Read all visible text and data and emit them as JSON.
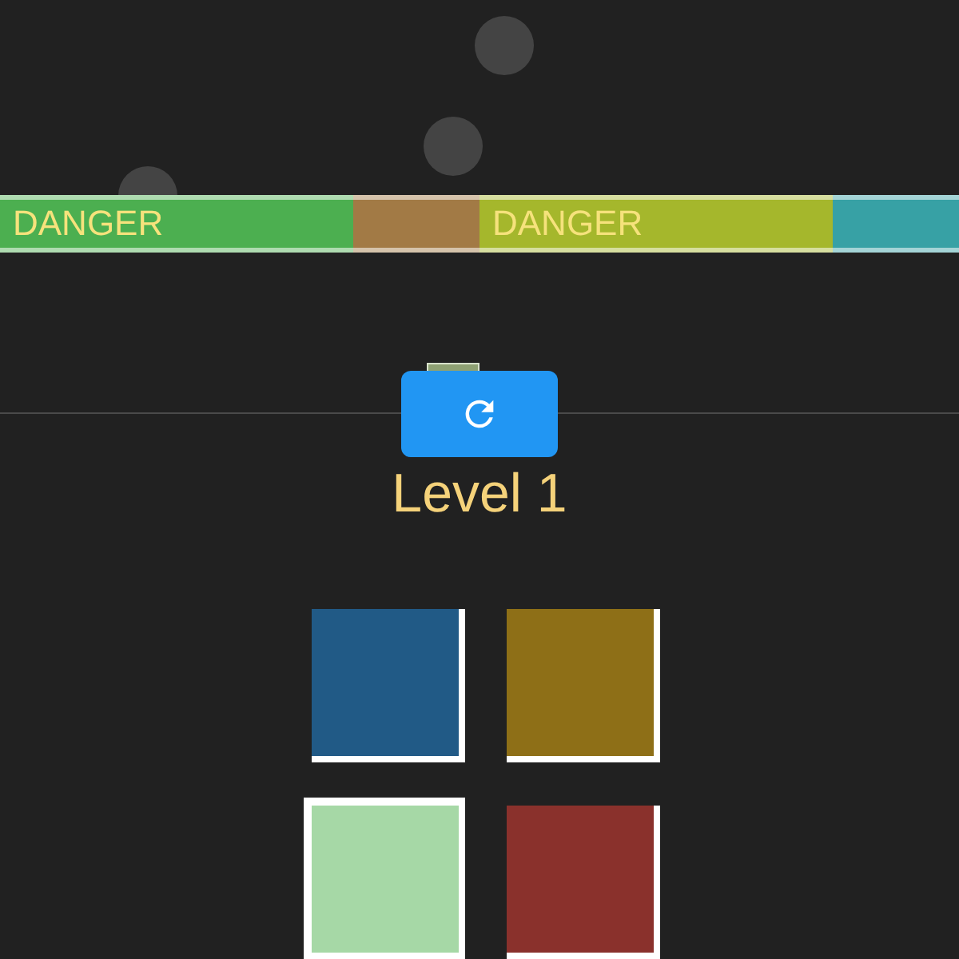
{
  "lanes": [
    {
      "label": "DANGER",
      "color": "#4caf50"
    },
    {
      "color": "#a27a45"
    },
    {
      "label": "DANGER",
      "color": "#a5b72c"
    },
    {
      "color": "#37a1a5"
    }
  ],
  "level": "Level 1",
  "tiles": [
    {
      "color": "#215a86",
      "selected": false
    },
    {
      "color": "#8e6f17",
      "selected": false
    },
    {
      "color": "#a6d8a6",
      "selected": true
    },
    {
      "color": "#8a312c",
      "selected": false
    }
  ]
}
